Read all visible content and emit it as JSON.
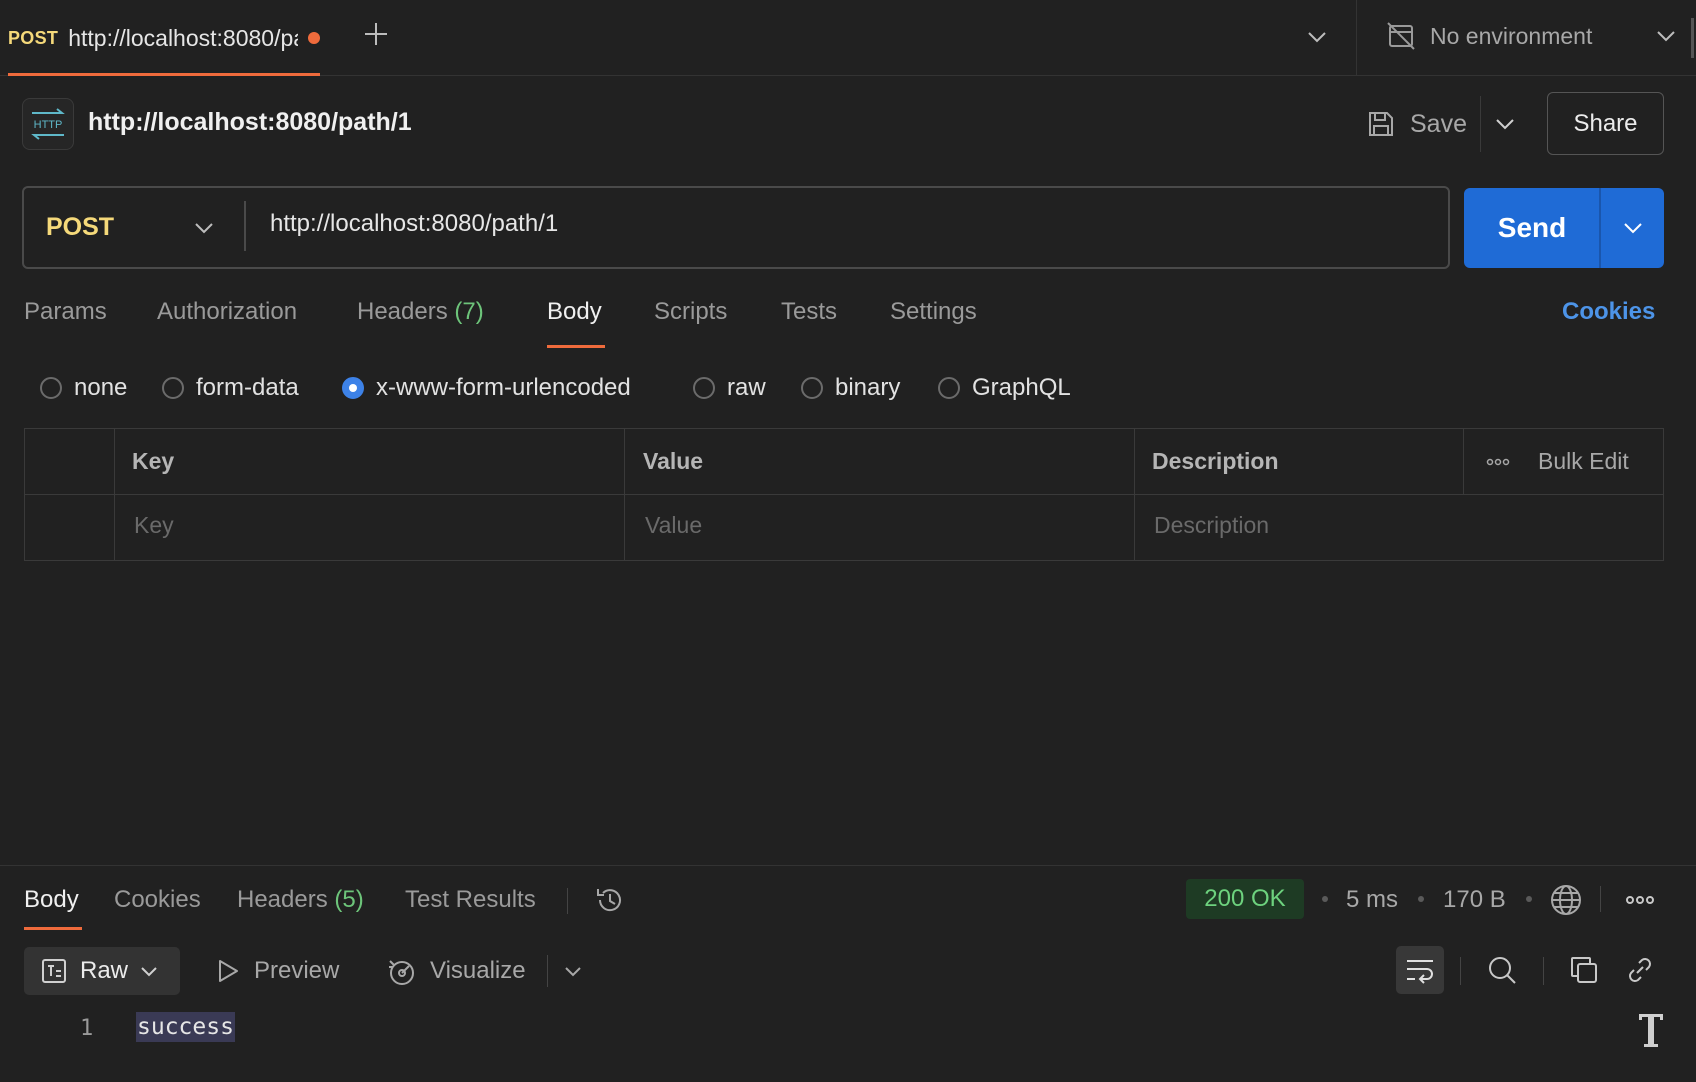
{
  "tab": {
    "method": "POST",
    "title": "http://localhost:8080/path/1",
    "unsaved_dot": true
  },
  "environment": {
    "label": "No environment"
  },
  "request": {
    "badge_text": "HTTP",
    "name": "http://localhost:8080/path/1",
    "save_label": "Save",
    "share_label": "Share",
    "method": "POST",
    "url": "http://localhost:8080/path/1",
    "send_label": "Send"
  },
  "request_tabs": {
    "params": "Params",
    "authorization": "Authorization",
    "headers": "Headers",
    "headers_count": "(7)",
    "body": "Body",
    "scripts": "Scripts",
    "tests": "Tests",
    "settings": "Settings",
    "cookies": "Cookies",
    "active": "Body"
  },
  "body_types": {
    "none": "none",
    "form_data": "form-data",
    "urlencoded": "x-www-form-urlencoded",
    "raw": "raw",
    "binary": "binary",
    "graphql": "GraphQL",
    "selected": "x-www-form-urlencoded"
  },
  "kv_table": {
    "headers": {
      "key": "Key",
      "value": "Value",
      "description": "Description"
    },
    "bulk_edit": "Bulk Edit",
    "placeholders": {
      "key": "Key",
      "value": "Value",
      "description": "Description"
    }
  },
  "response": {
    "tabs": {
      "body": "Body",
      "cookies": "Cookies",
      "headers": "Headers",
      "headers_count": "(5)",
      "test_results": "Test Results"
    },
    "status": "200 OK",
    "time": "5 ms",
    "size": "170 B",
    "format": "Raw",
    "preview": "Preview",
    "visualize": "Visualize",
    "line_number": "1",
    "body_text": "success"
  },
  "colors": {
    "background": "#212121",
    "accent_orange": "#ef6b3c",
    "method_yellow": "#f5d97a",
    "send_blue": "#1f6bd6",
    "status_green": "#6dd27e",
    "link_blue": "#4d94e8"
  },
  "icons": [
    "plus-icon",
    "chevron-down-icon",
    "no-environment-icon",
    "http-icon",
    "save-icon",
    "history-icon",
    "globe-icon",
    "more-icon",
    "raw-format-icon",
    "play-icon",
    "visualize-icon",
    "wrap-lines-icon",
    "search-icon",
    "copy-icon",
    "link-icon",
    "text-cursor-icon"
  ]
}
